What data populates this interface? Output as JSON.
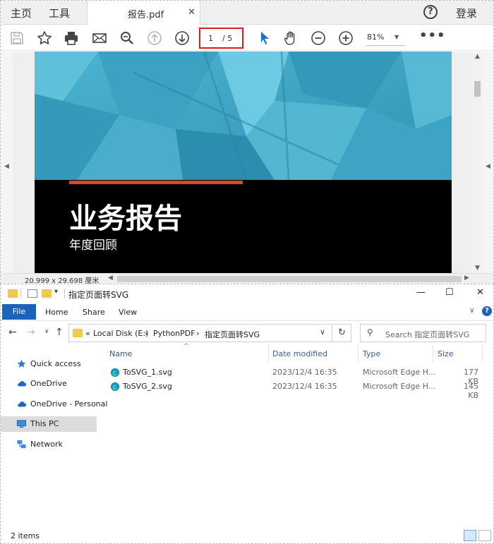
{
  "pdf": {
    "nav": {
      "home": "主页",
      "tools": "工具"
    },
    "tab": {
      "title": "报告.pdf",
      "close": "✕"
    },
    "help": "?",
    "login": "登录",
    "page": {
      "current": "1",
      "total": "/ 5"
    },
    "zoom": "81%",
    "more": "•••",
    "content": {
      "title": "业务报告",
      "subtitle": "年度回顾"
    },
    "dimensions": "20.999 x 29.698 厘米",
    "colors": {
      "accent_red": "#e01b1b",
      "cover_teal": "#3fa9c8",
      "red_bar": "#d9472b"
    }
  },
  "explorer": {
    "title": "指定页面转SVG",
    "window_controls": {
      "minimize": "—",
      "maximize": "☐",
      "close": "✕"
    },
    "ribbon": {
      "file": "File",
      "tabs": [
        "Home",
        "Share",
        "View"
      ]
    },
    "address": {
      "prefix": "«",
      "crumbs": [
        "Local Disk (E:)",
        "PythonPDF",
        "指定页面转SVG"
      ],
      "separator": "›"
    },
    "search_placeholder": "Search 指定页面转SVG",
    "nav_items": [
      {
        "label": "Quick access",
        "icon": "star-icon"
      },
      {
        "label": "OneDrive",
        "icon": "cloud-icon"
      },
      {
        "label": "OneDrive - Personal",
        "icon": "cloud-icon"
      },
      {
        "label": "This PC",
        "icon": "computer-icon"
      },
      {
        "label": "Network",
        "icon": "network-icon"
      }
    ],
    "columns": {
      "name": "Name",
      "date": "Date modified",
      "type": "Type",
      "size": "Size"
    },
    "files": [
      {
        "name": "ToSVG_1.svg",
        "date": "2023/12/4 16:35",
        "type": "Microsoft Edge H...",
        "size": "177 KB"
      },
      {
        "name": "ToSVG_2.svg",
        "date": "2023/12/4 16:35",
        "type": "Microsoft Edge H...",
        "size": "145 KB"
      }
    ],
    "status": "2 items",
    "accent": "#1a63b8"
  }
}
